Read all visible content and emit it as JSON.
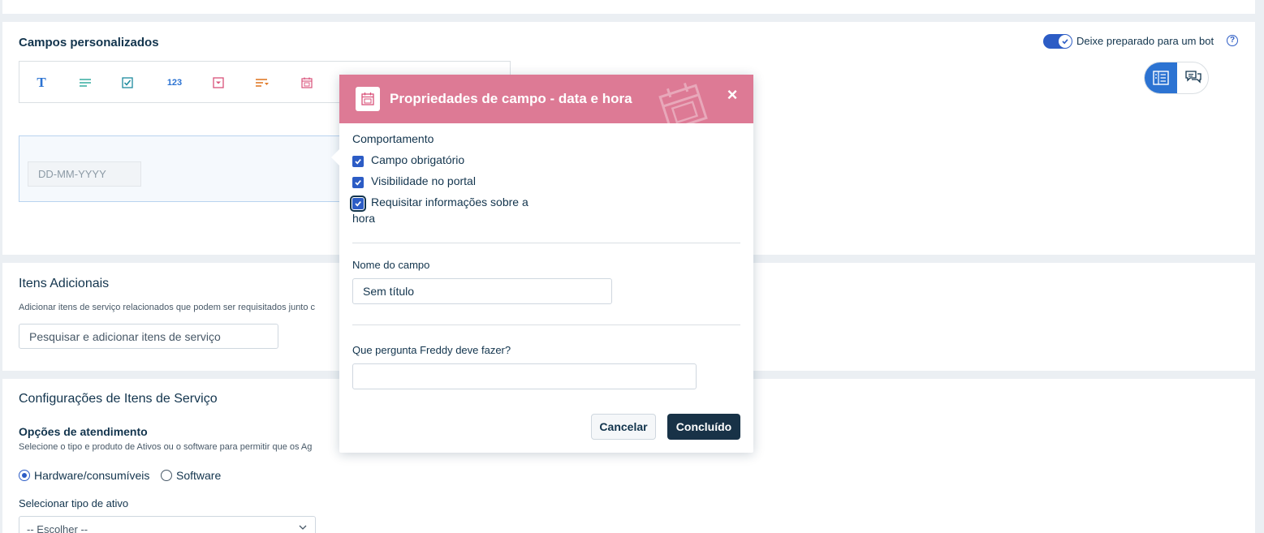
{
  "fields_card": {
    "title": "Campos personalizados",
    "bot_toggle_label": "Deixe preparado para um bot",
    "help_icon": "?",
    "toolbar": {
      "text_icon": "T",
      "number_icon": "123"
    },
    "date_placeholder": "DD-MM-YYYY"
  },
  "items_card": {
    "title": "Itens Adicionais",
    "description": "Adicionar itens de serviço relacionados que podem ser requisitados junto c",
    "search_placeholder": "Pesquisar e adicionar itens de serviço"
  },
  "config_card": {
    "title": "Configurações de Itens de Serviço",
    "subtitle": "Opções de atendimento",
    "description_left": "Selecione o tipo e produto de Ativos ou o software para permitir que os Ag",
    "radio_hardware": "Hardware/consumíveis",
    "radio_software": "Software",
    "select_label": "Selecionar tipo de ativo",
    "select_value": "-- Escolher --"
  },
  "modal": {
    "title": "Propriedades de campo - data e hora",
    "close": "×",
    "behavior_label": "Comportamento",
    "checkboxes": [
      {
        "label": "Campo obrigatório",
        "checked": true
      },
      {
        "label": "Visibilidade no portal",
        "checked": true
      },
      {
        "label": "Requisitar informações sobre a hora",
        "checked": true
      }
    ],
    "field_name_label": "Nome do campo",
    "field_name_value": "Sem título",
    "freddy_label": "Que pergunta Freddy deve fazer?",
    "freddy_value": "",
    "cancel_label": "Cancelar",
    "done_label": "Concluído"
  },
  "colors": {
    "accent": "#2c5cc5",
    "modal_header": "#dd7a95",
    "primary_button": "#183247"
  }
}
